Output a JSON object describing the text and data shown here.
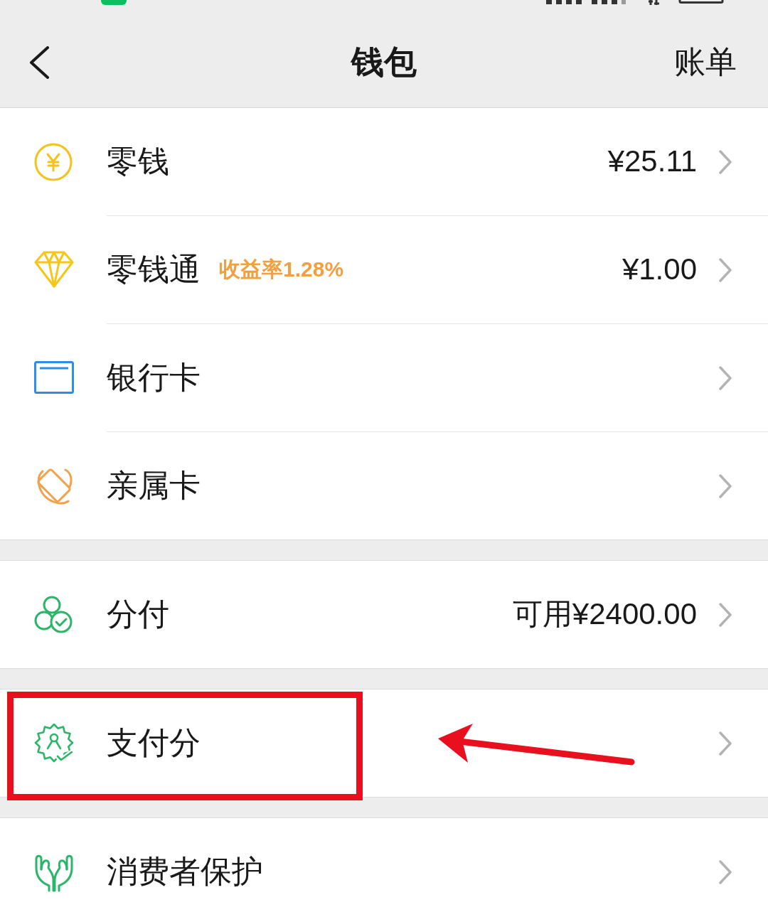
{
  "header": {
    "title": "钱包",
    "action": "账单"
  },
  "groups": [
    {
      "rows": [
        {
          "kind": "coin",
          "label": "零钱",
          "value": "¥25.11",
          "highlighted": false
        },
        {
          "kind": "diamond",
          "label": "零钱通",
          "tag": "收益率1.28%",
          "value": "¥1.00",
          "highlighted": false
        },
        {
          "kind": "card",
          "label": "银行卡",
          "highlighted": false
        },
        {
          "kind": "orbit",
          "label": "亲属卡",
          "highlighted": false
        }
      ]
    },
    {
      "rows": [
        {
          "kind": "circles",
          "label": "分付",
          "value": "可用¥2400.00",
          "highlighted": false
        }
      ]
    },
    {
      "rows": [
        {
          "kind": "badge",
          "label": "支付分",
          "highlighted": true
        }
      ]
    },
    {
      "rows": [
        {
          "kind": "hands",
          "label": "消费者保护",
          "highlighted": false
        }
      ]
    }
  ]
}
